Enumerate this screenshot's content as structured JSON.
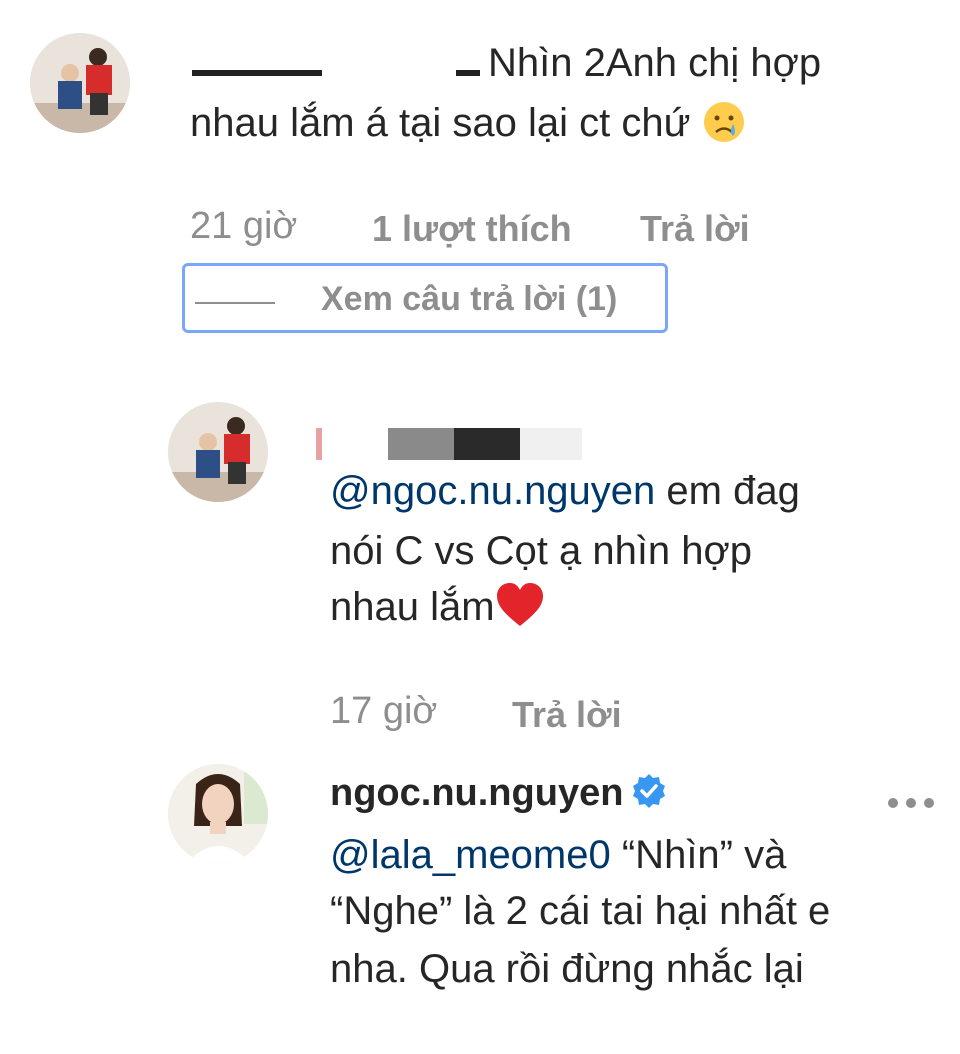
{
  "comment1": {
    "text_line1": "Nhìn 2Anh chị hợp",
    "text_line2": "nhau lắm á tại sao lại ct chứ",
    "emoji": "crying-face",
    "time": "21 giờ",
    "likes": "1 lượt thích",
    "reply": "Trả lời",
    "view_replies": "Xem câu trả lời (1)"
  },
  "comment2": {
    "mention": "@ngoc.nu.nguyen",
    "text_line1": " em đag",
    "text_line2": "nói C vs Cọt ạ nhìn hợp",
    "text_line3": "nhau lắm",
    "emoji": "red-heart",
    "time": "17 giờ",
    "reply": "Trả lời"
  },
  "comment3": {
    "username": "ngoc.nu.nguyen",
    "mention": "@lala_meome0",
    "text_line1": " “Nhìn” và",
    "text_line2": "“Nghe” là 2 cái tai hại nhất e",
    "text_line3": "nha. Qua rồi đừng nhắc lại"
  },
  "icons": {
    "more": "more-options-icon",
    "verified": "verified-badge-icon"
  },
  "colors": {
    "mention": "#00376b",
    "meta": "#8e8e8e",
    "focus_ring": "#7aa7f7",
    "verified": "#3897f0"
  }
}
